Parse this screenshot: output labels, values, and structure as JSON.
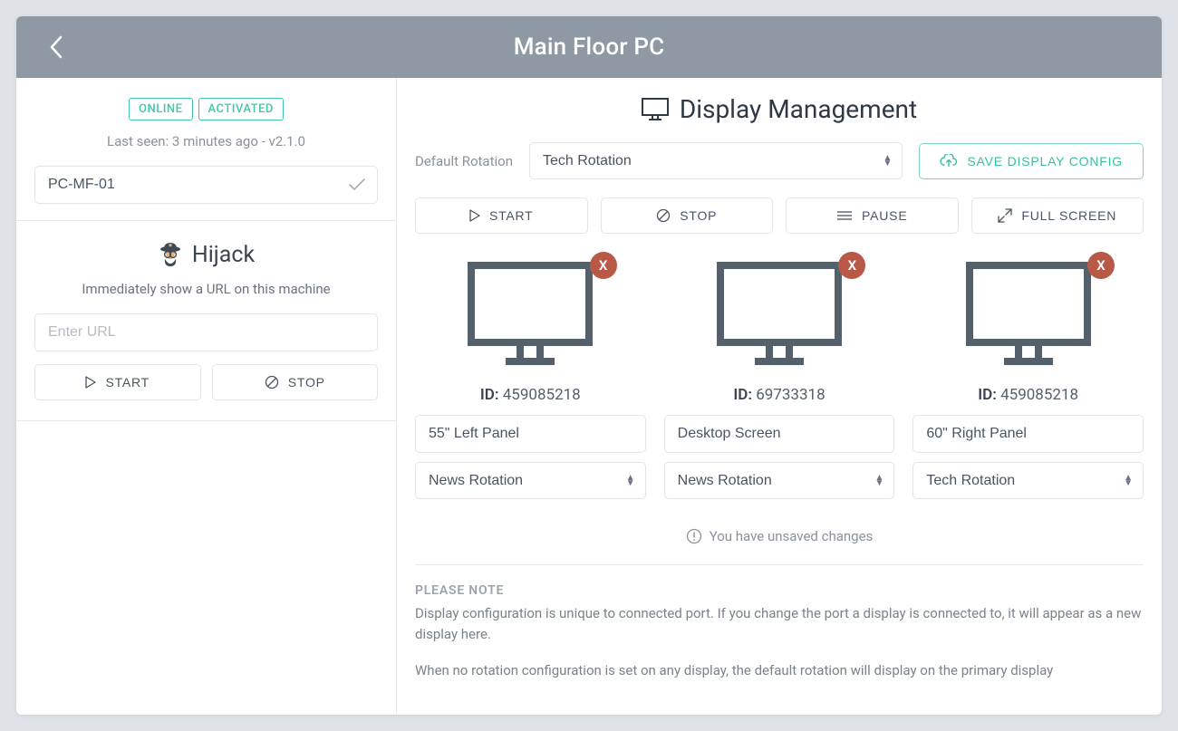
{
  "header": {
    "title": "Main Floor PC"
  },
  "sidebar": {
    "status": {
      "online_label": "ONLINE",
      "activated_label": "ACTIVATED"
    },
    "lastseen": "Last seen: 3 minutes ago - v2.1.0",
    "device_name": "PC-MF-01",
    "hijack": {
      "title": "Hijack",
      "description": "Immediately show a URL on this machine",
      "url_placeholder": "Enter URL",
      "start_label": "START",
      "stop_label": "STOP"
    }
  },
  "main": {
    "title": "Display Management",
    "default_rotation_label": "Default Rotation",
    "default_rotation_value": "Tech Rotation",
    "save_label": "SAVE DISPLAY CONFIG",
    "controls": {
      "start": "START",
      "stop": "STOP",
      "pause": "PAUSE",
      "fullscreen": "FULL SCREEN"
    },
    "id_prefix": "ID:",
    "displays": [
      {
        "id": "459085218",
        "name": "55\" Left Panel",
        "rotation": "News Rotation"
      },
      {
        "id": "69733318",
        "name": "Desktop Screen",
        "rotation": "News Rotation"
      },
      {
        "id": "459085218",
        "name": "60\" Right Panel",
        "rotation": "Tech Rotation"
      }
    ],
    "unsaved_message": "You have unsaved changes",
    "note_heading": "PLEASE NOTE",
    "note_text_1": "Display configuration is unique to connected port. If you change the port a display is connected to, it will appear as a new display here.",
    "note_text_2": "When no rotation configuration is set on any display, the default rotation will display on the primary display"
  }
}
